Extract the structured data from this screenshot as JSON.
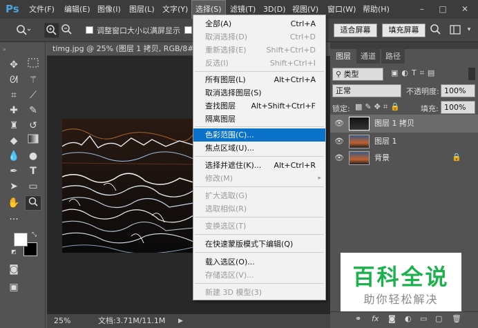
{
  "app": {
    "logo": "Ps"
  },
  "menubar": {
    "items": [
      "文件(F)",
      "编辑(E)",
      "图像(I)",
      "图层(L)",
      "文字(Y)",
      "选择(S)",
      "滤镜(T)",
      "3D(D)",
      "视图(V)",
      "窗口(W)",
      "帮助(H)"
    ],
    "window_controls": [
      "–",
      "□",
      "✕"
    ]
  },
  "options_bar": {
    "resize_windows_label": "调整窗口大小以满屏显示",
    "fit_screen": "适合屏幕",
    "fill_screen": "填充屏幕"
  },
  "document": {
    "tab_title": "timg.jpg @ 25% (图层 1 拷贝, RGB/8#) *",
    "tab_close": "×",
    "zoom": "25%",
    "doc_size": "文档:3.71M/11.1M"
  },
  "select_menu": {
    "items": [
      {
        "label": "全部(A)",
        "shortcut": "Ctrl+A",
        "disabled": false
      },
      {
        "label": "取消选择(D)",
        "shortcut": "Ctrl+D",
        "disabled": true
      },
      {
        "label": "重新选择(E)",
        "shortcut": "Shift+Ctrl+D",
        "disabled": true
      },
      {
        "label": "反选(I)",
        "shortcut": "Shift+Ctrl+I",
        "disabled": true
      },
      {
        "label": "所有图层(L)",
        "shortcut": "Alt+Ctrl+A",
        "disabled": false
      },
      {
        "label": "取消选择图层(S)",
        "shortcut": "",
        "disabled": false
      },
      {
        "label": "查找图层",
        "shortcut": "Alt+Shift+Ctrl+F",
        "disabled": false
      },
      {
        "label": "隔离图层",
        "shortcut": "",
        "disabled": false
      },
      {
        "label": "色彩范围(C)...",
        "shortcut": "",
        "disabled": false,
        "highlighted": true
      },
      {
        "label": "焦点区域(U)...",
        "shortcut": "",
        "disabled": false
      },
      {
        "label": "选择并遮住(K)...",
        "shortcut": "Alt+Ctrl+R",
        "disabled": false
      },
      {
        "label": "修改(M)",
        "shortcut": "",
        "disabled": true,
        "submenu": true
      },
      {
        "label": "扩大选取(G)",
        "shortcut": "",
        "disabled": true
      },
      {
        "label": "选取相似(R)",
        "shortcut": "",
        "disabled": true
      },
      {
        "label": "变换选区(T)",
        "shortcut": "",
        "disabled": true
      },
      {
        "label": "在快速蒙版模式下编辑(Q)",
        "shortcut": "",
        "disabled": false
      },
      {
        "label": "载入选区(O)...",
        "shortcut": "",
        "disabled": false
      },
      {
        "label": "存储选区(V)...",
        "shortcut": "",
        "disabled": true
      },
      {
        "label": "新建 3D 模型(3)",
        "shortcut": "",
        "disabled": true
      }
    ],
    "submenu_arrow": "▸"
  },
  "layers_panel": {
    "tabs": [
      "图层",
      "通道",
      "路径"
    ],
    "filter_kind": "类型",
    "blend_mode": "正常",
    "opacity_label": "不透明度:",
    "opacity_value": "100%",
    "lock_label": "锁定:",
    "fill_label": "填充:",
    "fill_value": "100%",
    "layers": [
      {
        "name": "图层 1 拷贝",
        "selected": true,
        "locked": false
      },
      {
        "name": "图层 1",
        "selected": false,
        "locked": false
      },
      {
        "name": "背景",
        "selected": false,
        "locked": true
      }
    ],
    "footer_fx": "fx"
  },
  "watermark": {
    "title": "百科全说",
    "subtitle": "助你轻松解决"
  },
  "colors": {
    "accent": "#0a72c9",
    "watermark_green": "#1db14d",
    "ps_blue": "#4aa3df"
  }
}
